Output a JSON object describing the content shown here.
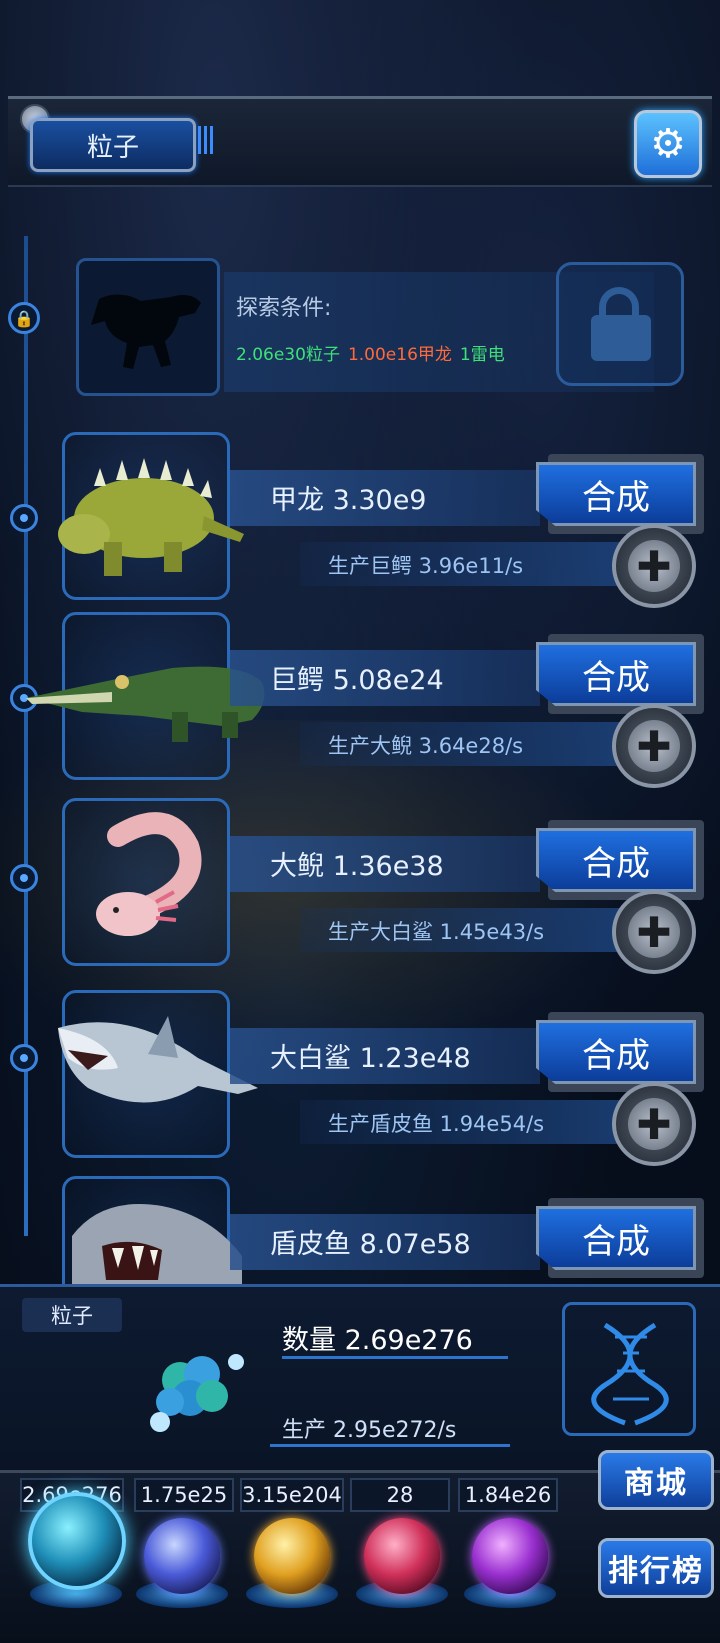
{
  "top_bar": {
    "resource_tab_label": "粒子",
    "settings_icon": "gear-icon"
  },
  "locked_entry": {
    "condition_title": "探索条件:",
    "requirements": [
      "2.06e30粒子",
      "1.00e16甲龙",
      "1雷电"
    ],
    "lock_icon": "lock-icon"
  },
  "creatures": [
    {
      "name_line": "甲龙 3.30e9",
      "production_line": "生产巨鳄 3.96e11/s",
      "synthesize_label": "合成"
    },
    {
      "name_line": "巨鳄 5.08e24",
      "production_line": "生产大鲵 3.64e28/s",
      "synthesize_label": "合成"
    },
    {
      "name_line": "大鲵 1.36e38",
      "production_line": "生产大白鲨 1.45e43/s",
      "synthesize_label": "合成"
    },
    {
      "name_line": "大白鲨 1.23e48",
      "production_line": "生产盾皮鱼 1.94e54/s",
      "synthesize_label": "合成"
    },
    {
      "name_line": "盾皮鱼 8.07e58",
      "production_line": "",
      "synthesize_label": "合成"
    }
  ],
  "info_panel": {
    "tab_label": "粒子",
    "quantity_line": "数量 2.69e276",
    "production_line": "生产 2.95e272/s",
    "dna_icon": "dna-icon"
  },
  "resources": [
    {
      "value": "2.69e276",
      "icon": "particle-orb-icon"
    },
    {
      "value": "1.75e25",
      "icon": "lightning-orb-icon"
    },
    {
      "value": "3.15e204",
      "icon": "fire-orb-icon"
    },
    {
      "value": "28",
      "icon": "brain-orb-icon"
    },
    {
      "value": "1.84e26",
      "icon": "vortex-orb-icon"
    }
  ],
  "side_buttons": {
    "shop_label": "商城",
    "ranking_label": "排行榜"
  }
}
